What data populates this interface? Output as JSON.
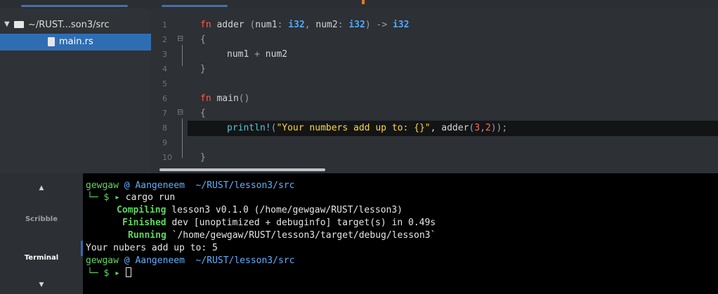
{
  "colors": {
    "selection": "#2f6db3",
    "keyword": "#ff5a4f",
    "type": "#51a9ff",
    "string": "#ffd83b",
    "terminal_green": "#5fd75f",
    "terminal_blue": "#5fb0ff"
  },
  "sidebar": {
    "folder_label": "~/RUST...son3/src",
    "folder_icon": "folder-icon",
    "file_label": "main.rs",
    "file_icon": "file-icon"
  },
  "editor": {
    "line_numbers": [
      "1",
      "2",
      "3",
      "4",
      "5",
      "6",
      "7",
      "8",
      "9",
      "10"
    ],
    "code": {
      "l1_kw": "fn",
      "l1_sig_a": " adder ",
      "l1_paren_open": "(",
      "l1_arg1": "num1",
      "l1_colon1": ": ",
      "l1_ty1": "i32",
      "l1_comma": ", ",
      "l1_arg2": "num2",
      "l1_colon2": ": ",
      "l1_ty2": "i32",
      "l1_paren_close": ")",
      "l1_arrow": " -> ",
      "l1_ty3": "i32",
      "l2": "{",
      "l3_a": "num1",
      "l3_op": " + ",
      "l3_b": "num2",
      "l4": "}",
      "l6_kw": "fn",
      "l6_name": " main",
      "l6_parens": "()",
      "l7": "{",
      "l8_macro": "println!",
      "l8_open": "(",
      "l8_str_a": "\"Your numbers add up to: ",
      "l8_braces": "{}",
      "l8_str_b": "\"",
      "l8_comma": ", adder",
      "l8_args_open": "(",
      "l8_n1": "3",
      "l8_argsep": ",",
      "l8_n2": "2",
      "l8_args_close": "))",
      "l8_semi": ";",
      "l10": "}"
    }
  },
  "dock": {
    "up_arrow": "▲",
    "scribble": "Scribble",
    "terminal": "Terminal",
    "down_arrow": "▼"
  },
  "terminal": {
    "user": "gewgaw",
    "at": " @ ",
    "host": "Aangeneem",
    "cwd": "  ~/RUST/lesson3/src",
    "tree": "└─ ",
    "prompt": "$ ▸ ",
    "command": "cargo run",
    "compiling_label": "Compiling",
    "compiling_text": " lesson3 v0.1.0 (/home/gewgaw/RUST/lesson3)",
    "finished_label": "Finished",
    "finished_text": " dev [unoptimized + debuginfo] target(s) in 0.49s",
    "running_label": "Running",
    "running_text": " `/home/gewgaw/RUST/lesson3/target/debug/lesson3`",
    "output": "Your nubers add up to: 5",
    "user2": "gewgaw",
    "at2": " @ ",
    "host2": "Aangeneem",
    "cwd2": "  ~/RUST/lesson3/src",
    "tree2": "└─ ",
    "prompt2": "$ ▸ "
  }
}
